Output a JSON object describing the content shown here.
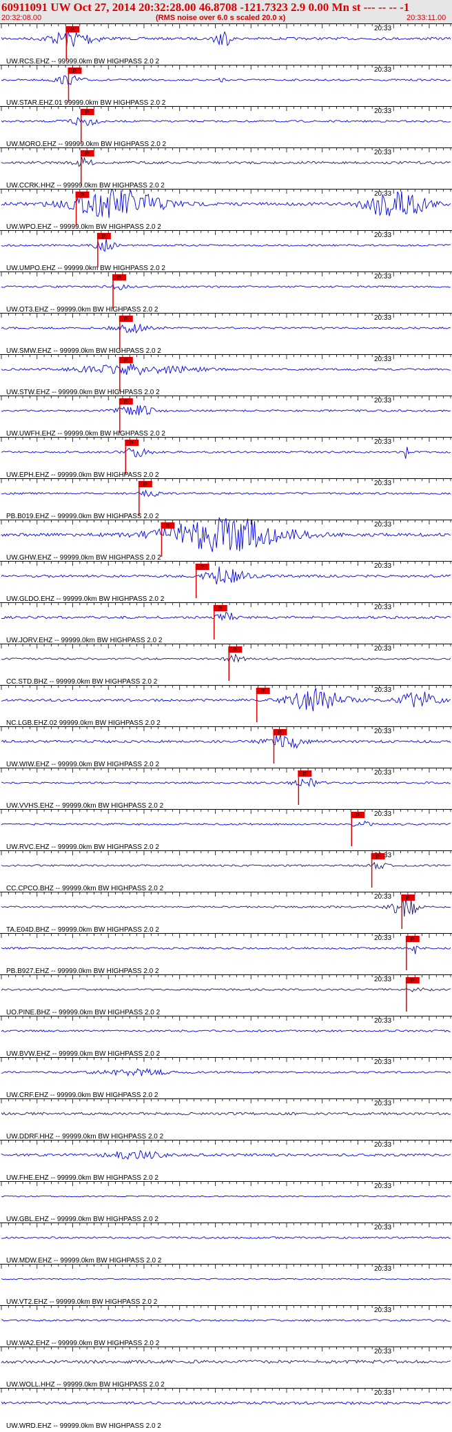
{
  "header": {
    "title": "60911091 UW Oct 27, 2014 20:32:28.00   46.8708 -121.7323  2.9 0.00 Mn st --- -- --  -1",
    "start_time": "20:32:08.00",
    "subtitle": "(RMS noise over 6.0 s scaled 20.0 x)",
    "end_time": "20:33:11.00"
  },
  "time_tick_label": "20:33",
  "pick_label": "P",
  "colors": {
    "header_bg": "#e6e6e6",
    "title_text": "#e00000",
    "trace_blue": "#0000e6",
    "trace_dark": "#1a1060",
    "pick_red": "#e00000",
    "axis": "#000000"
  },
  "traces": [
    {
      "label": "UW.RCS.EHZ -- 99999.0km BW  HIGHPASS  2.0  2",
      "color": "blue",
      "amp": 4,
      "pick": 0.143,
      "bursts": [
        [
          0.16,
          0.05,
          3
        ],
        [
          0.49,
          0.015,
          4.5
        ]
      ]
    },
    {
      "label": "UW.STAR.EHZ.01 99999.0km BW  HIGHPASS  2.0  2",
      "color": "blue",
      "amp": 3,
      "pick": 0.148,
      "bursts": [
        [
          0.15,
          0.03,
          2
        ],
        [
          0.49,
          0.01,
          1.5
        ]
      ]
    },
    {
      "label": "UW.MORO.EHZ -- 99999.0km BW  HIGHPASS  2.0  2",
      "color": "blue",
      "amp": 3,
      "pick": 0.176,
      "bursts": [
        [
          0.18,
          0.03,
          2.5
        ]
      ]
    },
    {
      "label": "UW.CCRK.HHZ -- 99999.0km BW  HIGHPASS  2.0  2",
      "color": "dark",
      "amp": 4,
      "pick": 0.176,
      "bursts": [
        [
          0.18,
          0.02,
          1.5
        ]
      ]
    },
    {
      "label": "UW.WPO.EHZ -- 99999.0km BW  HIGHPASS  2.0  2",
      "color": "blue",
      "amp": 5,
      "pick": 0.165,
      "bursts": [
        [
          0.26,
          0.1,
          4
        ],
        [
          0.88,
          0.06,
          5
        ]
      ]
    },
    {
      "label": "UW.UMPO.EHZ -- 99999.0km BW  HIGHPASS  2.0  2",
      "color": "blue",
      "amp": 3,
      "pick": 0.213,
      "bursts": [
        [
          0.23,
          0.02,
          3
        ]
      ]
    },
    {
      "label": "UW.OT3.EHZ -- 99999.0km BW  HIGHPASS  2.0  2",
      "color": "blue",
      "amp": 3,
      "pick": 0.247,
      "bursts": [
        [
          0.26,
          0.02,
          1.5
        ]
      ]
    },
    {
      "label": "UW.SMW.EHZ -- 99999.0km BW  HIGHPASS  2.0  2",
      "color": "blue",
      "amp": 3,
      "pick": 0.262,
      "bursts": [
        [
          0.29,
          0.04,
          2
        ]
      ]
    },
    {
      "label": "UW.STW.EHZ -- 99999.0km BW  HIGHPASS  2.0  2",
      "color": "blue",
      "amp": 3,
      "pick": 0.262,
      "bursts": [
        [
          0.3,
          0.12,
          2.5
        ]
      ]
    },
    {
      "label": "UW.UWFH.EHZ -- 99999.0km BW  HIGHPASS  2.0  2",
      "color": "blue",
      "amp": 3,
      "pick": 0.262,
      "bursts": [
        [
          0.3,
          0.04,
          2.5
        ]
      ]
    },
    {
      "label": "UW.EPH.EHZ -- 99999.0km BW  HIGHPASS  2.0  2",
      "color": "blue",
      "amp": 3,
      "pick": 0.275,
      "bursts": [
        [
          0.3,
          0.03,
          2
        ],
        [
          0.9,
          0.004,
          6
        ]
      ]
    },
    {
      "label": "PB.B019.EHZ -- 99999.0km BW  HIGHPASS  2.0  2",
      "color": "blue",
      "amp": 3,
      "pick": 0.305,
      "bursts": [
        [
          0.33,
          0.02,
          1.5
        ]
      ]
    },
    {
      "label": "UW.GHW.EHZ -- 99999.0km BW  HIGHPASS  2.0  2",
      "color": "blue",
      "amp": 5,
      "pick": 0.355,
      "bursts": [
        [
          0.5,
          0.13,
          5
        ]
      ]
    },
    {
      "label": "UW.GLDO.EHZ -- 99999.0km BW  HIGHPASS  2.0  2",
      "color": "blue",
      "amp": 4,
      "pick": 0.432,
      "bursts": [
        [
          0.5,
          0.04,
          3.5
        ]
      ]
    },
    {
      "label": "UW.JORV.EHZ -- 99999.0km BW  HIGHPASS  2.0  2",
      "color": "blue",
      "amp": 4,
      "pick": 0.472,
      "bursts": [
        [
          0.5,
          0.02,
          1.8
        ]
      ]
    },
    {
      "label": "CC.STD.BHZ -- 99999.0km BW  HIGHPASS  2.0  2",
      "color": "dark",
      "amp": 3,
      "pick": 0.505,
      "bursts": [
        [
          0.52,
          0.02,
          2
        ]
      ]
    },
    {
      "label": "NC.LGB.EHZ.02 99999.0km BW  HIGHPASS  2.0  2",
      "color": "blue",
      "amp": 4,
      "pick": 0.567,
      "bursts": [
        [
          0.7,
          0.06,
          4
        ],
        [
          0.93,
          0.04,
          3
        ]
      ]
    },
    {
      "label": "UW.WIW.EHZ -- 99999.0km BW  HIGHPASS  2.0  2",
      "color": "blue",
      "amp": 4,
      "pick": 0.605,
      "bursts": [
        [
          0.63,
          0.04,
          3
        ]
      ]
    },
    {
      "label": "UW.VVHS.EHZ -- 99999.0km BW  HIGHPASS  2.0  2",
      "color": "blue",
      "amp": 3,
      "pick": 0.66,
      "bursts": [
        [
          0.68,
          0.03,
          1.8
        ]
      ]
    },
    {
      "label": "UW.RVC.EHZ -- 99999.0km BW  HIGHPASS  2.0  2",
      "color": "blue",
      "amp": 3,
      "pick": 0.778,
      "bursts": [
        [
          0.8,
          0.02,
          1.3
        ]
      ]
    },
    {
      "label": "CC.CPCO.BHZ -- 99999.0km BW  HIGHPASS  2.0  2",
      "color": "dark",
      "amp": 3,
      "pick": 0.823,
      "bursts": [
        [
          0.84,
          0.02,
          1.3
        ]
      ]
    },
    {
      "label": "TA.E04D.BHZ -- 99999.0km BW  HIGHPASS  2.0  2",
      "color": "dark",
      "amp": 3,
      "pick": 0.89,
      "bursts": [
        [
          0.9,
          0.03,
          5
        ]
      ]
    },
    {
      "label": "PB.B927.EHZ -- 99999.0km BW  HIGHPASS  2.0  2",
      "color": "blue",
      "amp": 3,
      "pick": 0.9,
      "bursts": [
        [
          0.92,
          0.006,
          3
        ]
      ]
    },
    {
      "label": "UO.PINE.BHZ -- 99999.0km BW  HIGHPASS  2.0  2",
      "color": "dark",
      "amp": 3,
      "pick": 0.9,
      "bursts": [
        [
          0.93,
          0.02,
          1.2
        ]
      ]
    },
    {
      "label": "UW.BVW.EHZ -- 99999.0km BW  HIGHPASS  2.0  2",
      "color": "blue",
      "amp": 3,
      "pick": null,
      "bursts": []
    },
    {
      "label": "UW.CRF.EHZ -- 99999.0km BW  HIGHPASS  2.0  2",
      "color": "blue",
      "amp": 3,
      "pick": null,
      "bursts": [
        [
          0.3,
          0.08,
          1.4
        ]
      ]
    },
    {
      "label": "UW.DDRF.HHZ -- 99999.0km BW  HIGHPASS  2.0  2",
      "color": "dark",
      "amp": 4,
      "pick": null,
      "bursts": []
    },
    {
      "label": "UW.FHE.EHZ -- 99999.0km BW  HIGHPASS  2.0  2",
      "color": "blue",
      "amp": 4,
      "pick": null,
      "bursts": [
        [
          0.3,
          0.06,
          1.3
        ]
      ]
    },
    {
      "label": "UW.GBL.EHZ -- 99999.0km BW  HIGHPASS  2.0  2",
      "color": "blue",
      "amp": 2,
      "pick": null,
      "bursts": []
    },
    {
      "label": "UW.MDW.EHZ -- 99999.0km BW  HIGHPASS  2.0  2",
      "color": "blue",
      "amp": 3,
      "pick": null,
      "bursts": []
    },
    {
      "label": "UW.VT2.EHZ -- 99999.0km BW  HIGHPASS  2.0  2",
      "color": "blue",
      "amp": 2,
      "pick": null,
      "bursts": []
    },
    {
      "label": "UW.WA2.EHZ -- 99999.0km BW  HIGHPASS  2.0  2",
      "color": "blue",
      "amp": 3,
      "pick": null,
      "bursts": []
    },
    {
      "label": "UW.WOLL.HHZ -- 99999.0km BW  HIGHPASS  2.0  2",
      "color": "dark",
      "amp": 5,
      "pick": null,
      "bursts": []
    },
    {
      "label": "UW.WRD.EHZ -- 99999.0km BW  HIGHPASS  2.0  2",
      "color": "blue",
      "amp": 4,
      "pick": null,
      "bursts": []
    }
  ]
}
